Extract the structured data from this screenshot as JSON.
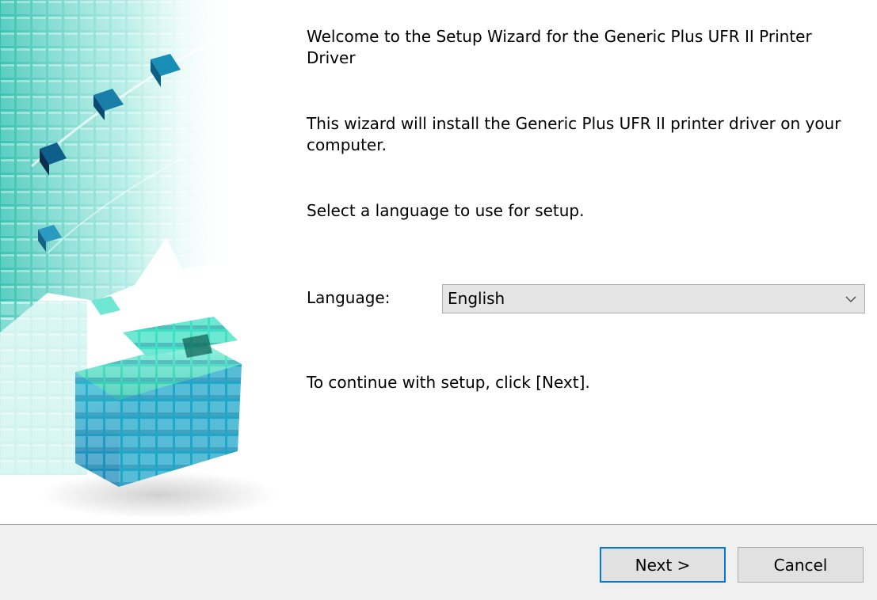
{
  "content": {
    "welcome_text": "Welcome to the Setup Wizard for the Generic Plus UFR II Printer Driver",
    "install_text": "This wizard will install the Generic Plus UFR II printer driver on your computer.",
    "select_text": "Select a language to use for setup.",
    "language_label": "Language:",
    "language_value": "English",
    "continue_text": "To continue with setup, click [Next]."
  },
  "buttons": {
    "next_label": "Next >",
    "cancel_label": "Cancel"
  },
  "icons": {
    "dropdown": "chevron-down-icon"
  },
  "colors": {
    "accent": "#0078d7",
    "footer_bg": "#f0f0f0",
    "button_bg": "#e1e1e1",
    "banner_teal": "#2ec9b8"
  }
}
